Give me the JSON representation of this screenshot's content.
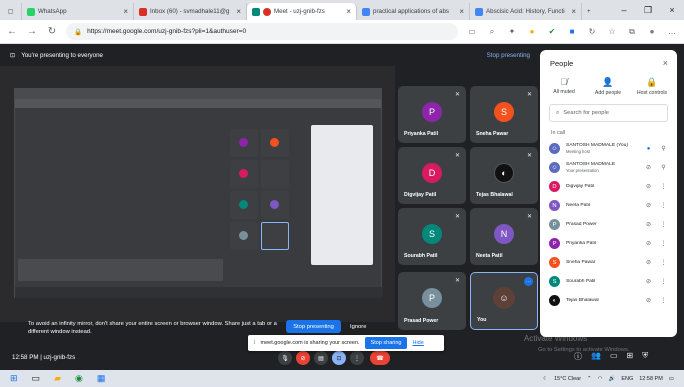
{
  "browser": {
    "tabs": [
      {
        "label": "WhatsApp",
        "color": "#25d366"
      },
      {
        "label": "Inbox (60) - svmadhale11@g",
        "color": "#d93025"
      },
      {
        "label": "Meet - uzj-gnib-fzs",
        "color": "#00897b"
      },
      {
        "label": "practical applications of abs",
        "color": "#4285f4"
      },
      {
        "label": "Abscisic Acid: History, Functi",
        "color": "#4285f4"
      }
    ],
    "new_tab": "+",
    "url": "https://meet.google.com/uzj-gnib-fzs?pli=1&authuser=0"
  },
  "banner": {
    "text": "You're presenting to everyone",
    "stop": "Stop presenting"
  },
  "presentation_hint": {
    "message": "To avoid an infinity mirror, don't share your entire screen or browser window. Share just a tab or a different window instead.",
    "stop_button": "Stop presenting",
    "ignore_button": "Ignore"
  },
  "tiles": [
    {
      "name": "Priyanka Patil",
      "initial": "P",
      "color": "#8e24aa"
    },
    {
      "name": "Sneha Pawar",
      "initial": "S",
      "color": "#f4511e"
    },
    {
      "name": "Digvijay Patil",
      "initial": "D",
      "color": "#d81b60"
    },
    {
      "name": "Tejas Bhalawal",
      "initial": "",
      "color": "#111111"
    },
    {
      "name": "Sourabh Patil",
      "initial": "S",
      "color": "#00897b"
    },
    {
      "name": "Neeta Patil",
      "initial": "N",
      "color": "#7e57c2"
    },
    {
      "name": "Prasad Power",
      "initial": "P",
      "color": "#78909c"
    },
    {
      "name": "You",
      "initial": "",
      "color": "#5d4037"
    }
  ],
  "people_panel": {
    "title": "People",
    "actions": [
      {
        "label": "All muted",
        "icon": "mic-off-icon"
      },
      {
        "label": "Add people",
        "icon": "add-person-icon"
      },
      {
        "label": "Host controls",
        "icon": "lock-icon"
      }
    ],
    "search_placeholder": "Search for people",
    "section": "In call",
    "people": [
      {
        "name": "SANTOSH MADMALE (You)",
        "sub": "Meeting host",
        "initial": "",
        "color": "#5c6bc0"
      },
      {
        "name": "SANTOSH MADMALE",
        "sub": "Your presentation",
        "initial": "",
        "color": "#5c6bc0"
      },
      {
        "name": "Digvijay Patil",
        "sub": "",
        "initial": "D",
        "color": "#d81b60"
      },
      {
        "name": "Neeta Patil",
        "sub": "",
        "initial": "N",
        "color": "#7e57c2"
      },
      {
        "name": "Prasad Power",
        "sub": "",
        "initial": "P",
        "color": "#78909c"
      },
      {
        "name": "Priyanka Patil",
        "sub": "",
        "initial": "P",
        "color": "#8e24aa"
      },
      {
        "name": "Sneha Pawar",
        "sub": "",
        "initial": "S",
        "color": "#f4511e"
      },
      {
        "name": "Sourabh Patil",
        "sub": "",
        "initial": "S",
        "color": "#00897b"
      },
      {
        "name": "Tejas Bhalawal",
        "sub": "",
        "initial": "",
        "color": "#111111"
      }
    ]
  },
  "bottom": {
    "time": "12:58 PM",
    "room": "uzj-gnib-fzs"
  },
  "share_notice": {
    "text": "meet.google.com is sharing your screen.",
    "stop": "Stop sharing",
    "hide": "Hide"
  },
  "watermark": {
    "title": "Activate Windows",
    "subtitle": "Go to Settings to activate Windows."
  },
  "taskbar": {
    "weather": "15°C Clear",
    "lang": "ENG",
    "time": "12:58 PM",
    "date": ""
  }
}
